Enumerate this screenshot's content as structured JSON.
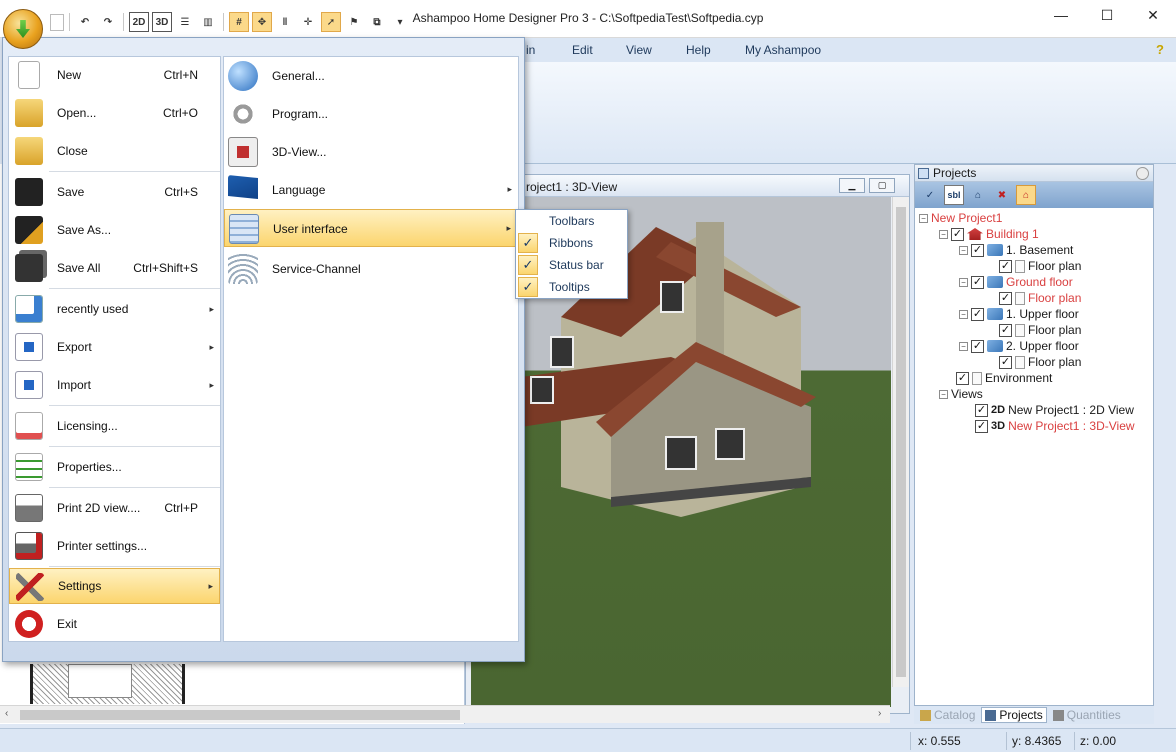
{
  "window": {
    "title": "Ashampoo Home Designer Pro 3 - C:\\SoftpediaTest\\Softpedia.cyp",
    "minimize": "—",
    "maximize": "☐",
    "close": "✕"
  },
  "quick_access": {
    "dropdown": "▾",
    "view2d": "2D",
    "view3d": "3D"
  },
  "menubar": {
    "items": [
      "in",
      "Edit",
      "View",
      "Help",
      "My Ashampoo"
    ],
    "help_symbol": "?"
  },
  "app_menu": {
    "items": [
      {
        "label": "New",
        "shortcut": "Ctrl+N"
      },
      {
        "label": "Open...",
        "shortcut": "Ctrl+O"
      },
      {
        "label": "Close",
        "shortcut": ""
      },
      {
        "label": "Save",
        "shortcut": "Ctrl+S"
      },
      {
        "label": "Save As...",
        "shortcut": ""
      },
      {
        "label": "Save All",
        "shortcut": "Ctrl+Shift+S"
      },
      {
        "label": "recently used",
        "shortcut": ""
      },
      {
        "label": "Export",
        "shortcut": ""
      },
      {
        "label": "Import",
        "shortcut": ""
      },
      {
        "label": "Licensing...",
        "shortcut": ""
      },
      {
        "label": "Properties...",
        "shortcut": ""
      },
      {
        "label": "Print 2D view....",
        "shortcut": "Ctrl+P"
      },
      {
        "label": "Printer settings...",
        "shortcut": ""
      },
      {
        "label": "Settings",
        "shortcut": ""
      },
      {
        "label": "Exit",
        "shortcut": ""
      }
    ],
    "submenu_arrow": "▸",
    "settings": [
      {
        "label": "General..."
      },
      {
        "label": "Program..."
      },
      {
        "label": "3D-View..."
      },
      {
        "label": "Language"
      },
      {
        "label": "User interface"
      },
      {
        "label": "Service-Channel"
      }
    ]
  },
  "user_interface_flyout": {
    "check_mark": "✓",
    "items": [
      {
        "label": "Toolbars",
        "checked": false
      },
      {
        "label": "Ribbons",
        "checked": true
      },
      {
        "label": "Status bar",
        "checked": true
      },
      {
        "label": "Tooltips",
        "checked": true
      }
    ]
  },
  "view3d": {
    "title": "roject1 : 3D-View"
  },
  "projects_panel": {
    "title": "Projects",
    "toolbar_check": "✓",
    "toolbar_sbl": "sbl",
    "tree": {
      "expanded": "−",
      "checked": "✓",
      "project": "New Project1",
      "building": "Building 1",
      "basement": "1. Basement",
      "ground_floor": "Ground floor",
      "upper_floor_1": "1. Upper floor",
      "upper_floor_2": "2. Upper floor",
      "floor_plan": "Floor plan",
      "environment": "Environment",
      "views": "Views",
      "view_2d_tag": "2D",
      "view_2d": "New Project1 : 2D View",
      "view_3d_tag": "3D",
      "view_3d": "New Project1 : 3D-View"
    }
  },
  "bottom_tabs": [
    "Catalog",
    "Projects",
    "Quantities"
  ],
  "statusbar": {
    "x": "x: 0.555",
    "y": "y: 8.4365",
    "z": "z: 0.00"
  },
  "scroll": {
    "left": "‹",
    "right": "›"
  },
  "colors": {
    "accent_highlight": "#fbd56e",
    "tree_active_red": "#d94040",
    "chrome_blue": "#dbe6f4"
  }
}
